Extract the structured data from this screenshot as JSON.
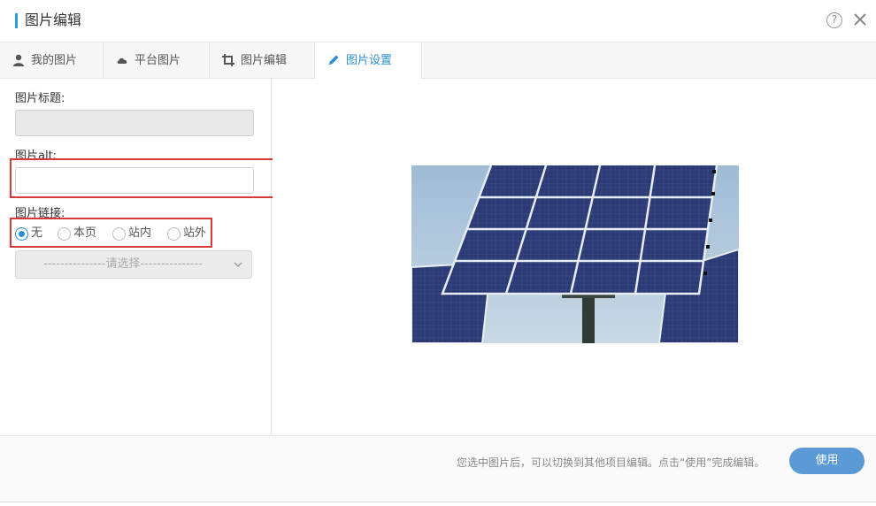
{
  "header": {
    "title": "图片编辑",
    "help_icon": "question-circle-icon",
    "help_symbol": "?",
    "close_icon": "close-icon",
    "accent_color": "#2e9bd6"
  },
  "tabs": [
    {
      "label": "我的图片",
      "icon": "user-icon",
      "active": false
    },
    {
      "label": "平台图片",
      "icon": "cloud-icon",
      "active": false
    },
    {
      "label": "图片编辑",
      "icon": "crop-icon",
      "active": false
    },
    {
      "label": "图片设置",
      "icon": "pencil-icon",
      "active": true
    }
  ],
  "form": {
    "title_label": "图片标题:",
    "title_value": "",
    "alt_label": "图片alt:",
    "alt_value": "",
    "link_label": "图片链接:",
    "link_options": [
      {
        "label": "无",
        "checked": true
      },
      {
        "label": "本页",
        "checked": false
      },
      {
        "label": "站内",
        "checked": false
      },
      {
        "label": "站外",
        "checked": false
      }
    ],
    "select_placeholder": "---------------请选择---------------"
  },
  "preview": {
    "image": "solar-panels-photo"
  },
  "footer": {
    "hint": "您选中图片后，可以切换到其他项目编辑。点击“使用”完成编辑。",
    "use_label": "使用",
    "button_color": "#5b9ad5"
  },
  "colors": {
    "active_tab": "#2e8fd0",
    "highlight_border": "#d63a3a"
  }
}
